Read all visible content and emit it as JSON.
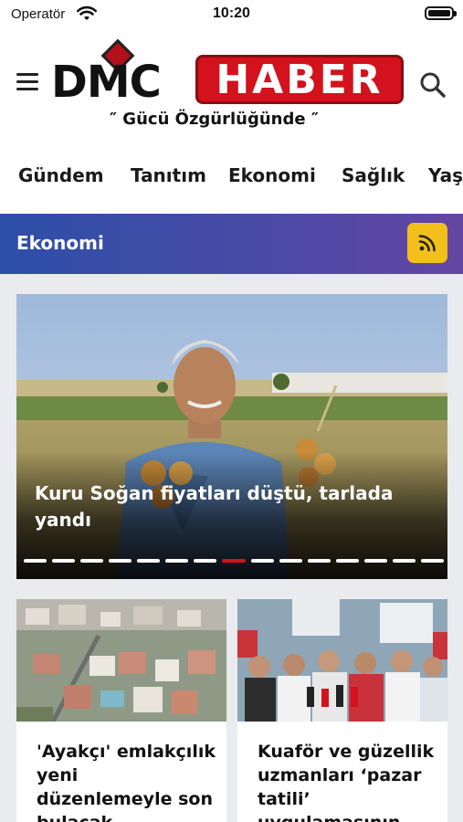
{
  "status_bar": {
    "carrier": "Operatör",
    "time": "10:20"
  },
  "header": {
    "logo_left": "DMC",
    "logo_right": "HABER",
    "slogan": "″ Gücü Özgürlüğünde ″"
  },
  "categories": [
    "Gündem",
    "Tanıtım",
    "Ekonomi",
    "Sağlık",
    "Yaşa"
  ],
  "section": {
    "title": "Ekonomi"
  },
  "featured": {
    "headline": "Kuru Soğan fiyatları düştü, tarlada yandı",
    "slide_count": 15,
    "active_slide": 7
  },
  "cards": [
    {
      "title": "'Ayakçı' emlakçılık yeni düzenlemeyle son bulacak"
    },
    {
      "title": "Kuaför ve güzellik uzmanları ‘pazar tatili’ uygulamasının"
    }
  ],
  "colors": {
    "brand_red": "#d3121d",
    "section_gradient_start": "#2d4fa8",
    "section_gradient_end": "#6346a2",
    "rss_yellow": "#f3bf1a",
    "content_bg": "#e9ebef"
  },
  "icons": {
    "menu": "hamburger-icon",
    "search": "search-icon",
    "rss": "rss-icon",
    "wifi": "wifi-icon",
    "battery": "battery-icon"
  }
}
